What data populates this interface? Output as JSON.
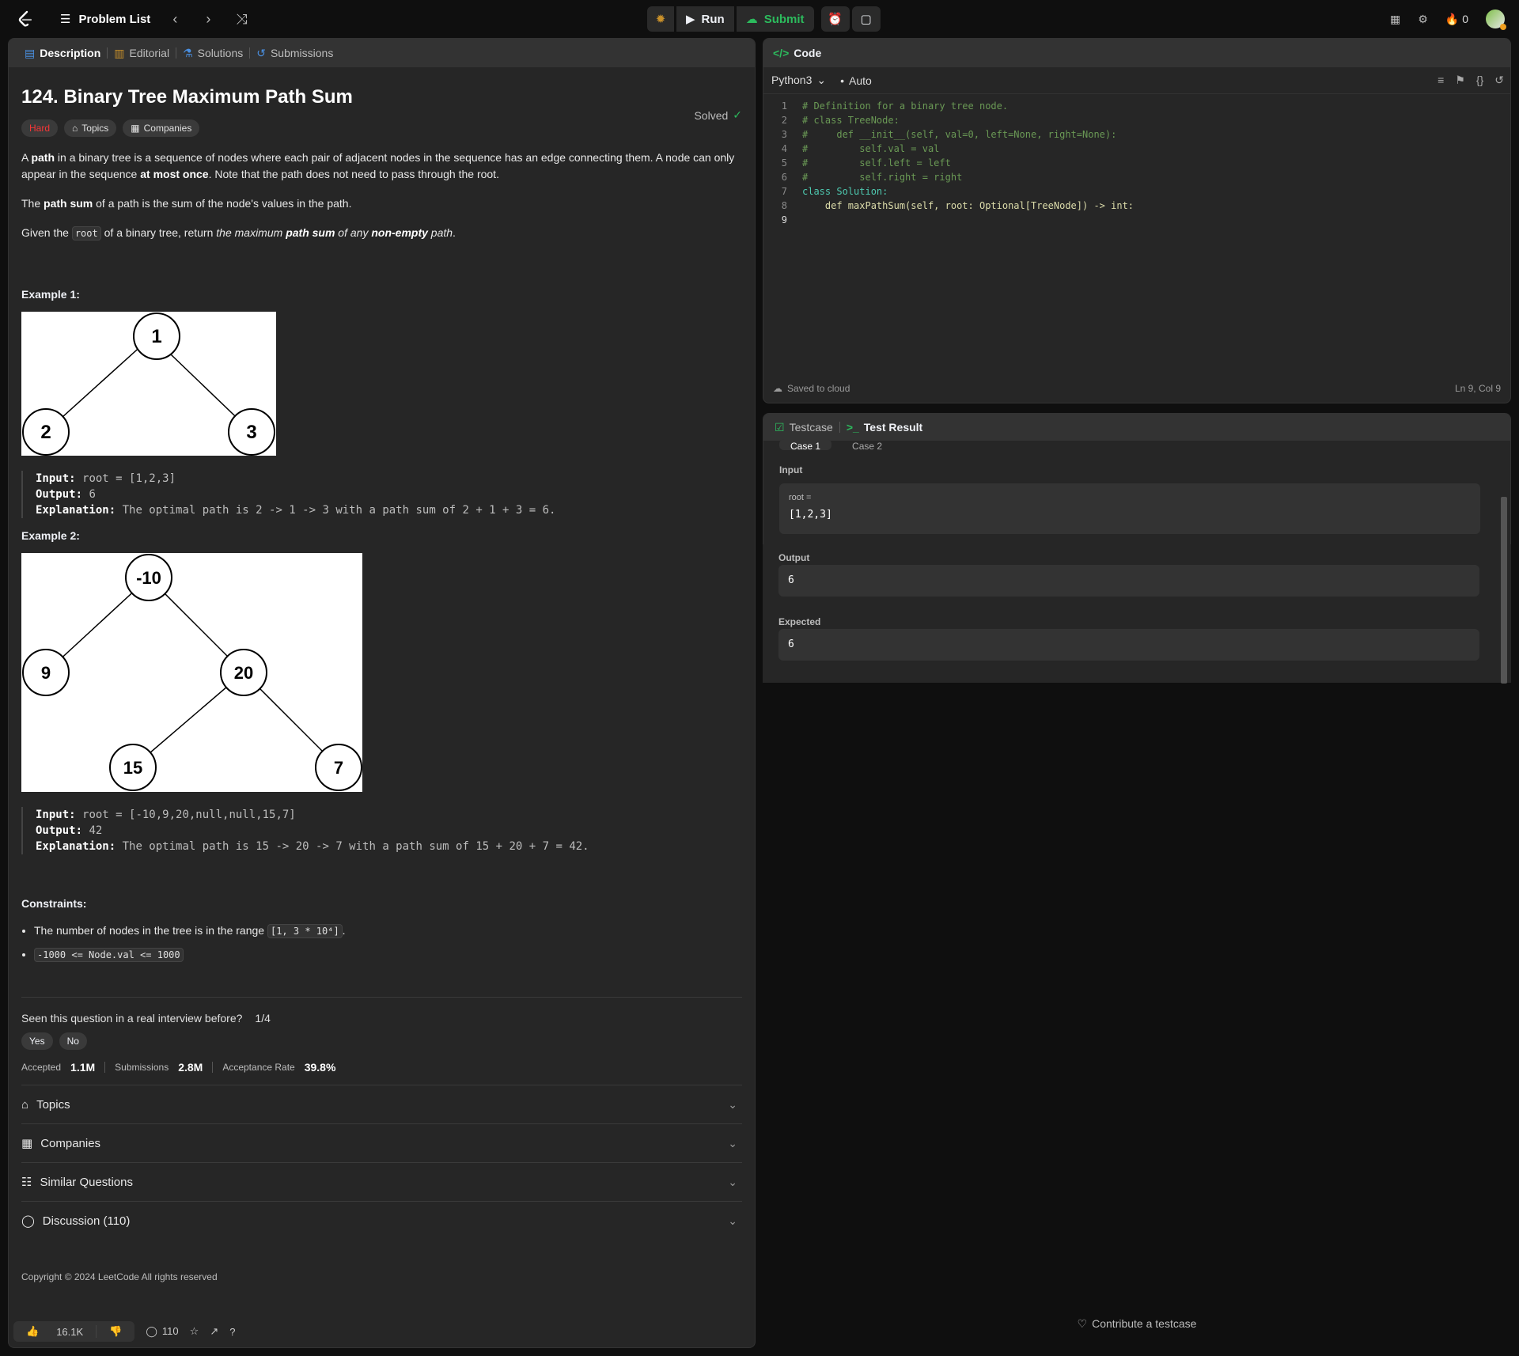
{
  "topbar": {
    "problem_list": "Problem List",
    "run": "Run",
    "submit": "Submit",
    "streak": "0"
  },
  "tabs": {
    "description": "Description",
    "editorial": "Editorial",
    "solutions": "Solutions",
    "submissions": "Submissions"
  },
  "problem": {
    "title": "124. Binary Tree Maximum Path Sum",
    "status": "Solved",
    "difficulty": "Hard",
    "topics": "Topics",
    "companies": "Companies",
    "p1a": "A ",
    "p1b": "path",
    "p1c": " in a binary tree is a sequence of nodes where each pair of adjacent nodes in the sequence has an edge connecting them. A node can only appear in the sequence ",
    "p1d": "at most once",
    "p1e": ". Note that the path does not need to pass through the root.",
    "p2a": "The ",
    "p2b": "path sum",
    "p2c": " of a path is the sum of the node's values in the path.",
    "p3a": "Given the ",
    "p3b": "root",
    "p3c": " of a binary tree, return ",
    "p3d": "the maximum ",
    "p3e": "path sum",
    "p3f": " of any ",
    "p3g": "non-empty",
    "p3h": " path",
    "p3i": "."
  },
  "example1": {
    "heading": "Example 1:",
    "nodes": [
      "1",
      "2",
      "3"
    ],
    "input_label": "Input:",
    "input": "root = [1,2,3]",
    "output_label": "Output:",
    "output": "6",
    "explanation_label": "Explanation:",
    "explanation": "The optimal path is 2 -> 1 -> 3 with a path sum of 2 + 1 + 3 = 6."
  },
  "example2": {
    "heading": "Example 2:",
    "nodes": [
      "-10",
      "9",
      "20",
      "15",
      "7"
    ],
    "input_label": "Input:",
    "input": "root = [-10,9,20,null,null,15,7]",
    "output_label": "Output:",
    "output": "42",
    "explanation_label": "Explanation:",
    "explanation": "The optimal path is 15 -> 20 -> 7 with a path sum of 15 + 20 + 7 = 42."
  },
  "constraints": {
    "heading": "Constraints:",
    "c1_text": "The number of nodes in the tree is in the range ",
    "c1_code": "[1, 3 * 10⁴]",
    "c1_end": ".",
    "c2_code": "-1000 <= Node.val <= 1000"
  },
  "survey": {
    "question": "Seen this question in a real interview before?",
    "count": "1/4",
    "yes": "Yes",
    "no": "No"
  },
  "stats": {
    "accepted_label": "Accepted",
    "accepted": "1.1M",
    "submissions_label": "Submissions",
    "submissions": "2.8M",
    "rate_label": "Acceptance Rate",
    "rate": "39.8%"
  },
  "accordion": {
    "topics": "Topics",
    "companies": "Companies",
    "similar": "Similar Questions",
    "discussion": "Discussion (110)"
  },
  "footer": {
    "copyright": "Copyright © 2024 LeetCode All rights reserved",
    "likes": "16.1K",
    "comments": "110"
  },
  "code": {
    "header": "Code",
    "language": "Python3",
    "mode": "Auto",
    "lines": [
      "# Definition for a binary tree node.",
      "# class TreeNode:",
      "#     def __init__(self, val=0, left=None, right=None):",
      "#         self.val = val",
      "#         self.left = left",
      "#         self.right = right",
      "class Solution:",
      "    def maxPathSum(self, root: Optional[TreeNode]) -> int:",
      ""
    ],
    "line_numbers": [
      "1",
      "2",
      "3",
      "4",
      "5",
      "6",
      "7",
      "8",
      "9"
    ],
    "saved": "Saved to cloud",
    "cursor": "Ln 9, Col 9"
  },
  "results": {
    "testcase_tab": "Testcase",
    "result_tab": "Test Result",
    "case1": "Case 1",
    "case2": "Case 2",
    "input_label": "Input",
    "param": "root =",
    "input_value": "[1,2,3]",
    "output_label": "Output",
    "output_value": "6",
    "expected_label": "Expected",
    "expected_value": "6",
    "contribute": "Contribute a testcase"
  },
  "colors": {
    "accent_green": "#2cbb5d",
    "hard_red": "#f63636",
    "tab_blue": "#4a90e2"
  }
}
